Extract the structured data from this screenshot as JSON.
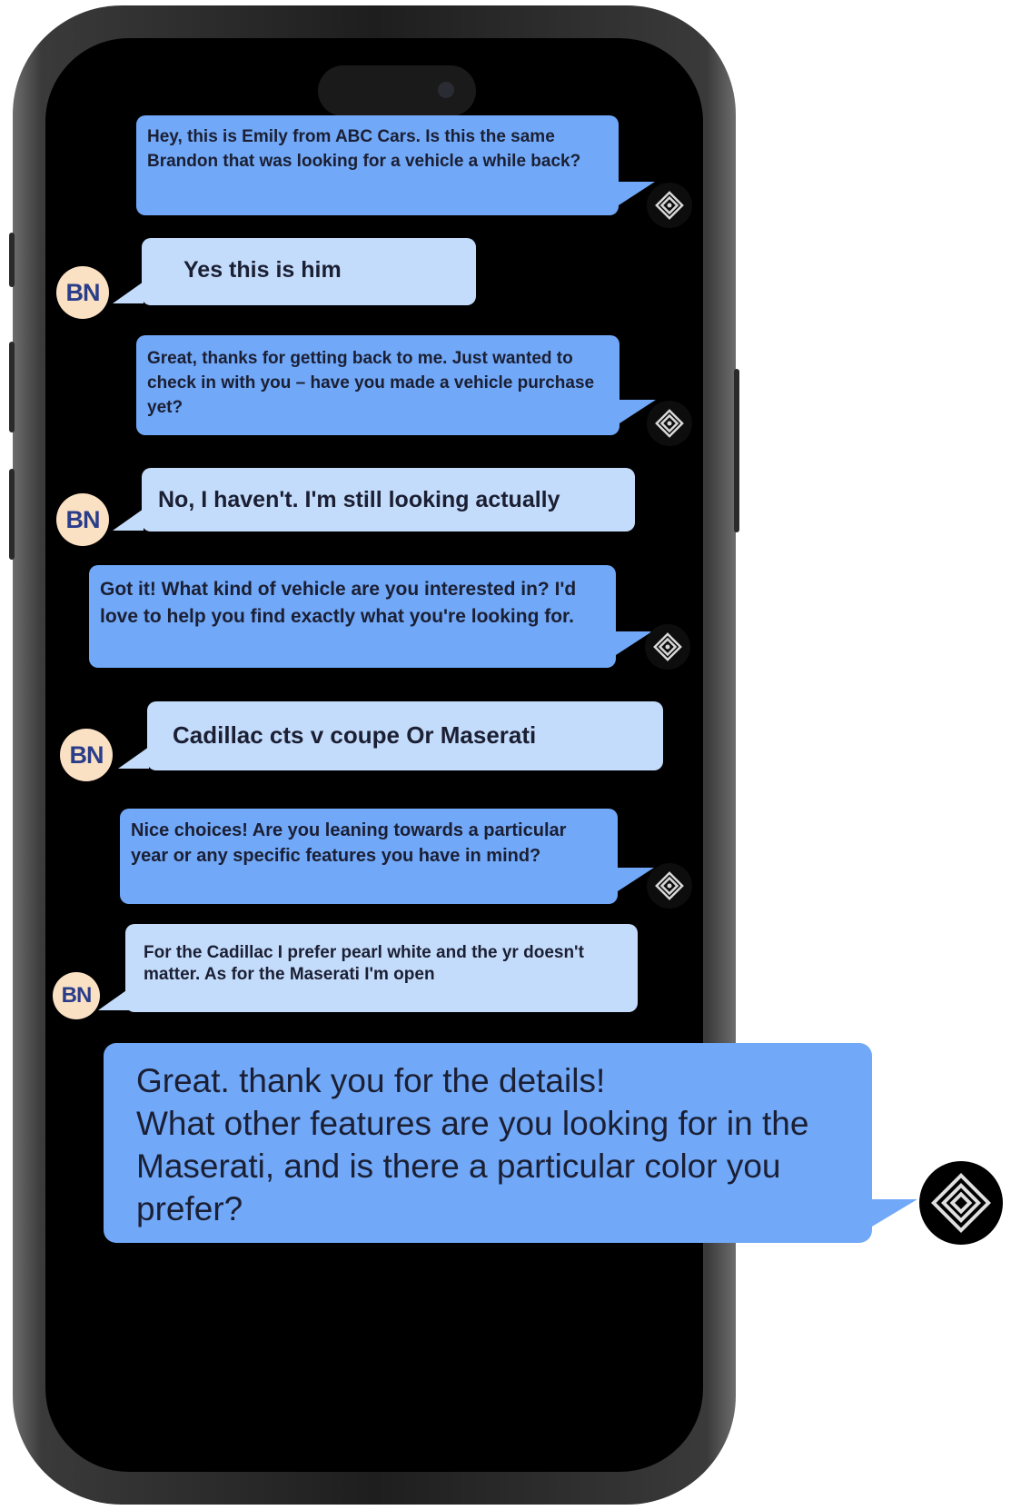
{
  "messages": [
    {
      "sender": "agent",
      "text": "Hey, this is Emily from ABC Cars. Is this the same Brandon that was looking for a vehicle a while back?"
    },
    {
      "sender": "user",
      "avatar": "BN",
      "text": "Yes this is him"
    },
    {
      "sender": "agent",
      "text": "Great, thanks for getting back to me. Just wanted to check in with you – have you made a vehicle purchase yet?"
    },
    {
      "sender": "user",
      "avatar": "BN",
      "text": "No, I haven't. I'm still looking actually"
    },
    {
      "sender": "agent",
      "text": "Got it! What kind of vehicle are you interested in? I'd love to help you find exactly what you're looking for."
    },
    {
      "sender": "user",
      "avatar": "BN",
      "text": "Cadillac cts v coupe Or Maserati"
    },
    {
      "sender": "agent",
      "text": "Nice choices! Are you leaning towards a particular year or any specific features you have in mind?"
    },
    {
      "sender": "user",
      "avatar": "BN",
      "text": "For the Cadillac I prefer pearl white and the yr doesn't matter. As for the Maserati I'm open"
    },
    {
      "sender": "agent",
      "text": "Great. thank you for the details!\nWhat other features are you looking for in the Maserati, and is there a particular color you prefer?"
    }
  ],
  "icons": {
    "agent_logo": "diamond-logo-icon",
    "user_avatar": "user-avatar-initials"
  },
  "colors": {
    "agent_bubble": "#71a8f8",
    "user_bubble": "#c4dcfb",
    "avatar_bg": "#fbe1c3",
    "avatar_text": "#2a3d8a",
    "screen": "#000000"
  }
}
